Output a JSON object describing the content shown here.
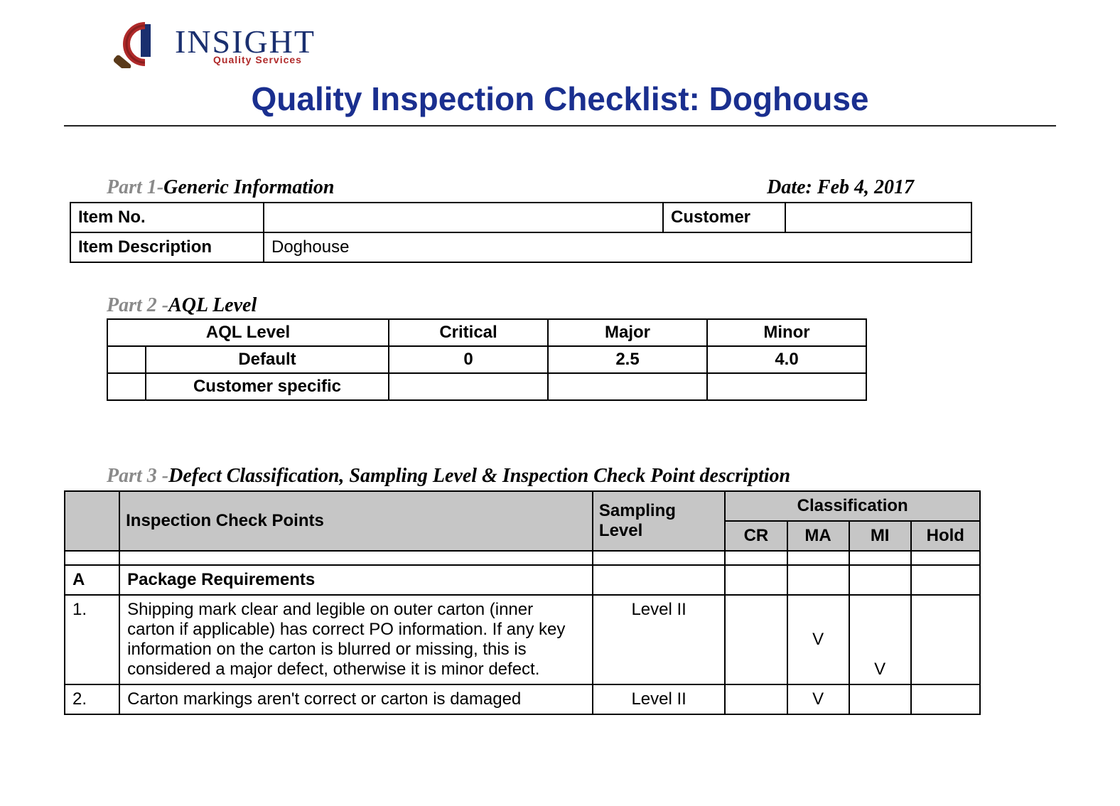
{
  "logo": {
    "brand_top": "INSIGHT",
    "brand_sub": "Quality Services"
  },
  "title": "Quality Inspection Checklist: Doghouse",
  "part1": {
    "label_gray": "Part 1-",
    "label_black": "Generic Information",
    "date_label": "Date: ",
    "date_value": "Feb 4, 2017",
    "fields": {
      "item_no_label": "Item No.",
      "item_no_value": "",
      "customer_label": "Customer",
      "customer_value": "",
      "item_desc_label": "Item Description",
      "item_desc_value": "Doghouse"
    }
  },
  "part2": {
    "label_gray": "Part 2 -",
    "label_black": "AQL Level",
    "headers": {
      "aql": "AQL Level",
      "critical": "Critical",
      "major": "Major",
      "minor": "Minor"
    },
    "rows": [
      {
        "label": "Default",
        "critical": "0",
        "major": "2.5",
        "minor": "4.0"
      },
      {
        "label": "Customer specific",
        "critical": "",
        "major": "",
        "minor": ""
      }
    ]
  },
  "part3": {
    "label_gray": "Part 3 -",
    "label_black": "Defect Classification, Sampling Level & Inspection Check Point description",
    "headers": {
      "check_points": "Inspection Check Points",
      "sampling": "Sampling Level",
      "classification": "Classification",
      "cr": "CR",
      "ma": "MA",
      "mi": "MI",
      "hold": "Hold"
    },
    "section_a": {
      "letter": "A",
      "title": "Package Requirements"
    },
    "rows": [
      {
        "num": "1.",
        "desc": "Shipping mark clear and legible on outer carton (inner carton if applicable) has correct PO information. If any key information on the carton is blurred or missing, this is considered a major defect, otherwise it is minor defect.",
        "sampling": "Level II",
        "cr": "",
        "ma": "V",
        "mi": "V",
        "hold": ""
      },
      {
        "num": "2.",
        "desc": "Carton markings aren't correct or carton is damaged",
        "sampling": "Level II",
        "cr": "",
        "ma": "V",
        "mi": "",
        "hold": ""
      }
    ]
  }
}
